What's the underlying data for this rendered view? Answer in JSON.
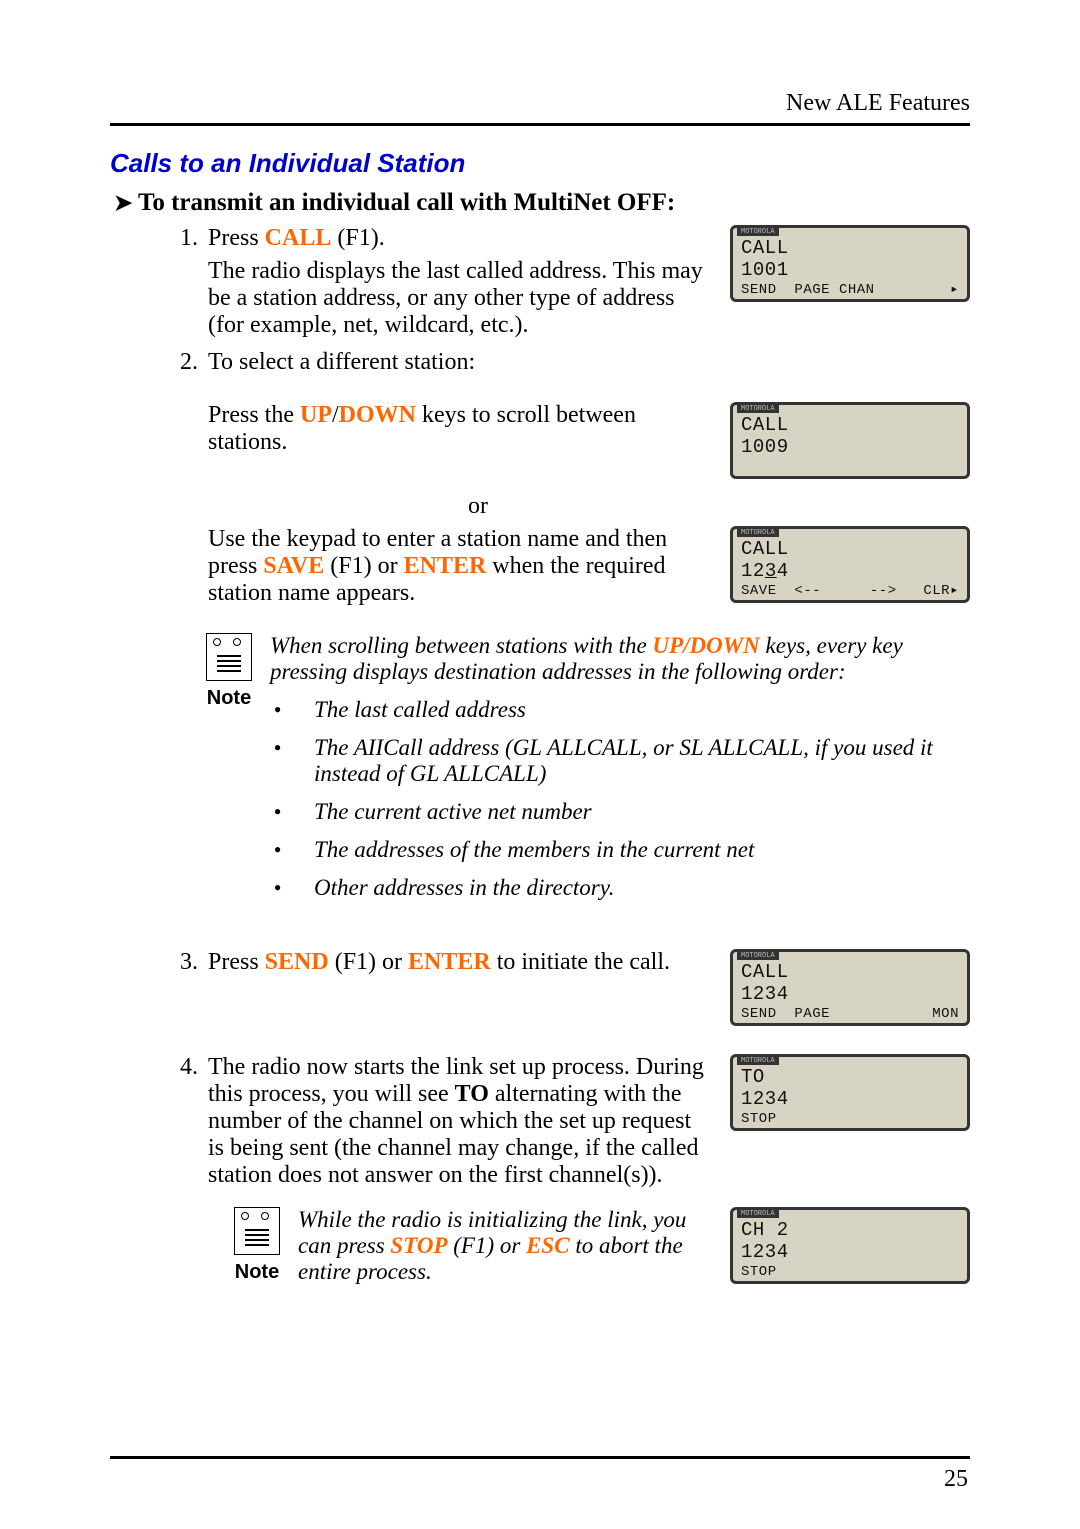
{
  "header_title": "New ALE Features",
  "section_title": "Calls to an Individual Station",
  "arrow_heading": "To transmit an individual call with MultiNet OFF:",
  "steps": {
    "s1_num": "1.",
    "s1_a": "Press ",
    "s1_key": "CALL",
    "s1_b": " (F1).",
    "s1_desc": "The radio displays the last called address. This may be a station address, or any other type of address (for example, net, wildcard, etc.).",
    "s2_num": "2.",
    "s2_a": "To select a different station:",
    "s2_press": "Press the ",
    "s2_key1": "UP",
    "s2_slash": "/",
    "s2_key2": "DOWN",
    "s2_rest": " keys to scroll between stations.",
    "or": "or",
    "s2_keypad_a": "Use the keypad to enter a station name and then press ",
    "s2_keypad_key1": "SAVE",
    "s2_keypad_b": " (F1) or ",
    "s2_keypad_key2": "ENTER",
    "s2_keypad_c": " when the required station name appears.",
    "s3_num": "3.",
    "s3_a": "Press ",
    "s3_key1": "SEND",
    "s3_b": " (F1) or ",
    "s3_key2": "ENTER",
    "s3_c": " to initiate the call.",
    "s4_num": "4.",
    "s4_a": "The radio now starts the link set up process. During this process, you will see ",
    "s4_to": "TO",
    "s4_b": " alternating with the number of the channel on which the set up request is being sent (the channel may change, if the called station does not answer on the first channel(s))."
  },
  "note_label": "Note",
  "note1": {
    "line1_a": "When scrolling between stations with the ",
    "line1_key": "UP/DOWN",
    "line1_b": " keys, every key pressing displays destination addresses in the following order:",
    "b1": "The last called address",
    "b2": "The AIICall address (GL ALLCALL, or SL ALLCALL, if you used it instead of GL ALLCALL)",
    "b3": "The current active net number",
    "b4": "The addresses of the members in the current net",
    "b5": "Other addresses in the directory."
  },
  "note2": {
    "a": "While the radio is initializing the link, you can press ",
    "key1": "STOP",
    "b": " (F1) or ",
    "key2": "ESC",
    "c": " to abort the entire process."
  },
  "lcd1": {
    "l1": "CALL",
    "l2": "1001",
    "f1": "SEND",
    "f2": "PAGE",
    "f3": "CHAN"
  },
  "lcd2": {
    "l1": "CALL",
    "l2": "1009"
  },
  "lcd3": {
    "l1": "CALL",
    "l2": "1234",
    "f1": "SAVE",
    "f2": "<--",
    "f3": "-->",
    "f4": "CLR"
  },
  "lcd4": {
    "l1": "CALL",
    "l2": "1234",
    "f1": "SEND",
    "f2": "PAGE",
    "f4": "MON"
  },
  "lcd5": {
    "l1": "TO",
    "l2": "1234",
    "f1": "STOP"
  },
  "lcd6": {
    "l1": "CH 2",
    "l2": "1234",
    "f1": "STOP"
  },
  "brand": "MOTOROLA",
  "page_number": "25"
}
